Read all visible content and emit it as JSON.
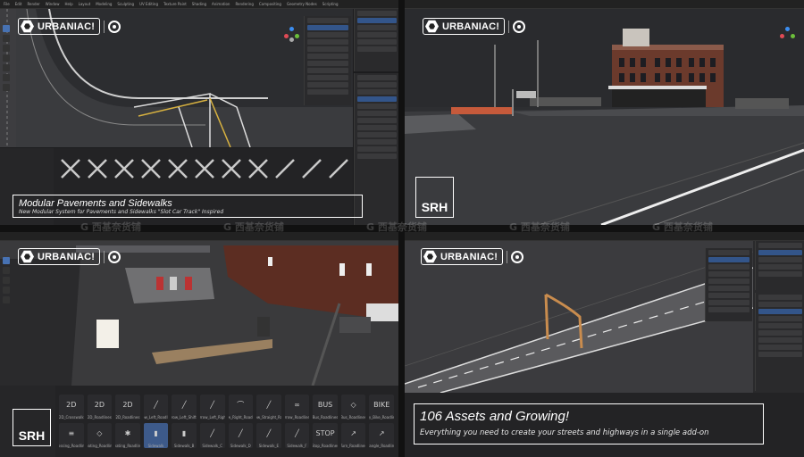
{
  "brand": {
    "name": "URBANIAC!"
  },
  "watermark": {
    "text": "G 西基奈货铺"
  },
  "srh": {
    "label": "SRH"
  },
  "panel_tl": {
    "menu": [
      "File",
      "Edit",
      "Render",
      "Window",
      "Help",
      "Layout",
      "Modeling",
      "Sculpting",
      "UV Editing",
      "Texture Paint",
      "Shading",
      "Animation",
      "Rendering",
      "Compositing",
      "Geometry Nodes",
      "Scripting"
    ],
    "title_line": "Modular Pavements and Sidewalks",
    "subtitle_line": "New Modular System for Pavements and Sidewalks \"Slot Car Track\" Inspired"
  },
  "panel_bl": {
    "assets": [
      {
        "icon": "2D",
        "label": "2D_Crosswalk"
      },
      {
        "icon": "2D",
        "label": "2D_Roadlines"
      },
      {
        "icon": "2D",
        "label": "2D_Roadlines"
      },
      {
        "icon": "╱",
        "label": "Arrow_Left_Roadlines"
      },
      {
        "icon": "╱",
        "label": "Arrow_Left_Shifted"
      },
      {
        "icon": "╱",
        "label": "Arrow_Left_Right"
      },
      {
        "icon": "⌒",
        "label": "Arrow_Right_Roadlines"
      },
      {
        "icon": "╱",
        "label": "Arrow_Straight_Roadl"
      },
      {
        "icon": "∞",
        "label": "Arrow_Roadlines"
      },
      {
        "icon": "BUS",
        "label": "Bus_Roadlines"
      },
      {
        "icon": "◇",
        "label": "Bus_Roadlines"
      },
      {
        "icon": "BIKE",
        "label": "City_Bike_Roadlines"
      },
      {
        "icon": "≡",
        "label": "Crossing_Roadlines"
      },
      {
        "icon": "◇",
        "label": "Floating_Roadlines"
      },
      {
        "icon": "✱",
        "label": "Floating_Roadlines"
      },
      {
        "icon": "▮",
        "label": "Sidewalk"
      },
      {
        "icon": "▮",
        "label": "Sidewalk_B"
      },
      {
        "icon": "╱",
        "label": "Sidewalk_C"
      },
      {
        "icon": "╱",
        "label": "Sidewalk_D"
      },
      {
        "icon": "╱",
        "label": "Sidewalk_E"
      },
      {
        "icon": "╱",
        "label": "Sidewalk_F"
      },
      {
        "icon": "STOP",
        "label": "Stop_Roadlines"
      },
      {
        "icon": "↗",
        "label": "Turn_Roadlines"
      },
      {
        "icon": "↗",
        "label": "Triangle_Roadlines"
      }
    ]
  },
  "panel_br": {
    "headline": "106 Assets and Growing!",
    "tagline": "Everything you need to create your streets and highways in a single add-on"
  }
}
